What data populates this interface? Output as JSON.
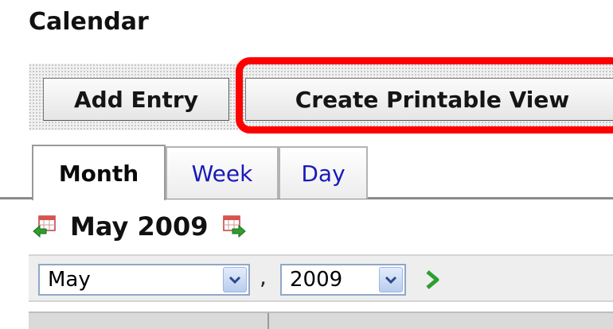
{
  "page": {
    "title": "Calendar"
  },
  "toolbar": {
    "add_entry_label": "Add Entry",
    "printable_view_label": "Create Printable View"
  },
  "tabs": [
    {
      "label": "Month",
      "active": true
    },
    {
      "label": "Week",
      "active": false
    },
    {
      "label": "Day",
      "active": false
    }
  ],
  "navigation": {
    "current_period": "May 2009",
    "prev_icon": "calendar-previous-icon",
    "next_icon": "calendar-next-icon"
  },
  "date_selector": {
    "month_value": "May",
    "separator": ",",
    "year_value": "2009",
    "go_icon": "go-arrow-icon"
  },
  "colors": {
    "highlight": "#ff0000",
    "tab_link": "#1a1ab8",
    "go_arrow": "#2e9e2e"
  }
}
